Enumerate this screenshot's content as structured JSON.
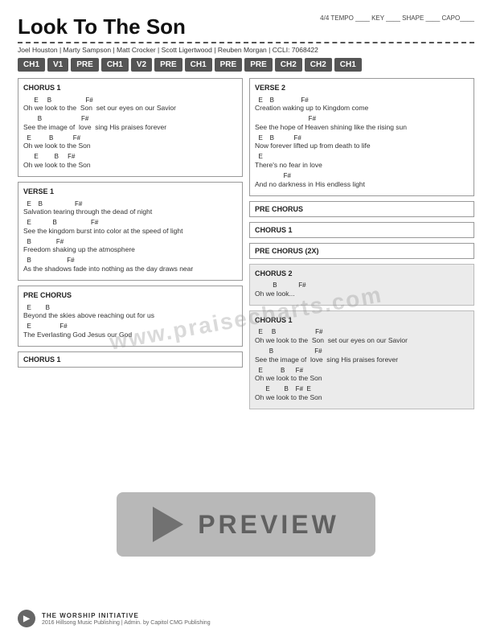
{
  "title": "Look To The Son",
  "time_signature": "4/4",
  "tempo_label": "TEMPO",
  "key_label": "KEY",
  "shape_label": "SHAPE",
  "capo_label": "CAPO",
  "authors": "Joel Houston | Marty Sampson | Matt Crocker | Scott Ligertwood | Reuben Morgan | CCLI: 7068422",
  "nav_items": [
    "CH1",
    "V1",
    "PRE",
    "CH1",
    "V2",
    "PRE",
    "CH1",
    "PRE",
    "PRE",
    "CH2",
    "CH2",
    "CH1"
  ],
  "chorus1": {
    "title": "CHORUS 1",
    "stanzas": [
      {
        "chords": "E      B                    F#",
        "lyric": "Oh we look to the   Son  set our eyes on our Savior"
      },
      {
        "chords": "       B                         F#",
        "lyric": "See the image of   love   sing His praises forever"
      },
      {
        "chords": "E           B            F#",
        "lyric": "Oh we look to the Son"
      },
      {
        "chords": "E           B      F#",
        "lyric": "Oh we look to the Son"
      }
    ]
  },
  "verse1": {
    "title": "VERSE 1",
    "stanzas": [
      {
        "chords": "E    B                  F#",
        "lyric": "Salvation tearing through the dead of night"
      },
      {
        "chords": "E              B                   F#",
        "lyric": "See the kingdom burst into color at the speed of light"
      },
      {
        "chords": "B              F#",
        "lyric": "Freedom shaking up the atmosphere"
      },
      {
        "chords": "B                   F#",
        "lyric": "As the shadows fade into nothing as the day draws near"
      }
    ]
  },
  "pre_chorus_left": {
    "title": "PRE CHORUS",
    "stanzas": [
      {
        "chords": "E        B",
        "lyric": "Beyond the skies above reaching out for us"
      },
      {
        "chords": "E              F#",
        "lyric": "The Everlasting God Jesus our God"
      }
    ]
  },
  "chorus1_label_left": {
    "title": "CHORUS 1"
  },
  "verse2": {
    "title": "VERSE 2",
    "stanzas": [
      {
        "chords": "E    B               F#",
        "lyric": "Creation waking up to Kingdom come"
      },
      {
        "chords": "                              F#",
        "lyric": "See the hope of Heaven shining like the rising sun"
      },
      {
        "chords": "E    B            F#",
        "lyric": "Now forever lifted up from death to life"
      },
      {
        "chords": "E",
        "lyric": "There's no fear in love"
      },
      {
        "chords": "              F#",
        "lyric": "And no darkness in His endless light"
      }
    ]
  },
  "pre_chorus_right_label": {
    "title": "PRE CHORUS"
  },
  "chorus1_right_label": {
    "title": "CHORUS 1"
  },
  "pre_chorus_2x_label": {
    "title": "PRE CHORUS (2X)"
  },
  "chorus2_preview": {
    "title": "CHORUS 2",
    "stanzas": [
      {
        "chords": "          B                F#",
        "lyric": "Oh we look..."
      }
    ]
  },
  "chorus1_bottom": {
    "title": "CHORUS 1",
    "stanzas": [
      {
        "chords": "E      B                         F#",
        "lyric": "Oh we look to the   Son  set our eyes on our Savior"
      },
      {
        "chords": "       B                         F#",
        "lyric": "See the image of   love   sing His praises forever"
      },
      {
        "chords": "E           B       F#",
        "lyric": "Oh we look to the Son"
      },
      {
        "chords": "E           B    F#   E",
        "lyric": "Oh we look to the Son"
      }
    ]
  },
  "watermark": "www.praisecharts.com",
  "preview_label": "PREVIEW",
  "footer": {
    "org": "THE WORSHIP INITIATIVE",
    "copyright": "2016 Hillsong Music Publishing | Admin. by Capitol CMG Publishing"
  }
}
